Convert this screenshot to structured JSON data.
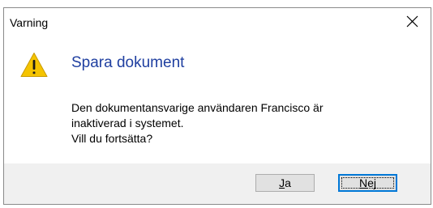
{
  "window": {
    "title": "Varning",
    "close_icon": "close-icon"
  },
  "content": {
    "icon": "warning-icon",
    "heading": "Spara dokument",
    "message_lines": [
      "Den dokumentansvarige användaren Francisco är",
      "inaktiverad i systemet.",
      "Vill du fortsätta?"
    ]
  },
  "buttons": {
    "yes": {
      "mnemonic": "J",
      "rest": "a"
    },
    "no": {
      "mnemonic": "N",
      "rest": "ej"
    }
  },
  "colors": {
    "heading": "#1f3fa0",
    "warning_fill": "#f5c400",
    "footer_bg": "#f0f0f0",
    "focus_border": "#0078d7"
  }
}
